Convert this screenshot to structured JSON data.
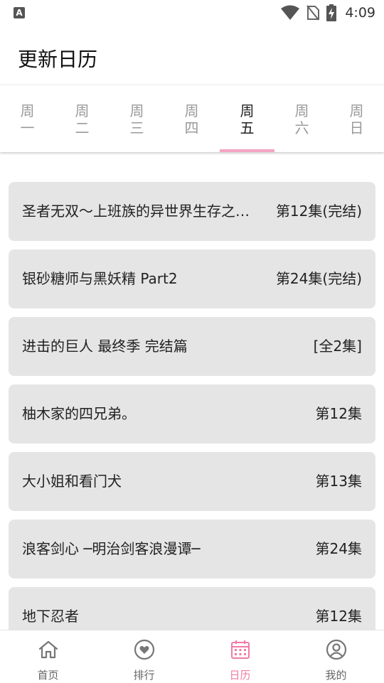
{
  "status_bar": {
    "time": "4:09",
    "notification_letter": "A"
  },
  "header": {
    "title": "更新日历"
  },
  "week_tabs": [
    {
      "line1": "周",
      "line2": "一"
    },
    {
      "line1": "周",
      "line2": "二"
    },
    {
      "line1": "周",
      "line2": "三"
    },
    {
      "line1": "周",
      "line2": "四"
    },
    {
      "line1": "周",
      "line2": "五",
      "active": true
    },
    {
      "line1": "周",
      "line2": "六"
    },
    {
      "line1": "周",
      "line2": "日"
    }
  ],
  "schedule": [
    {
      "title": "圣者无双～上班族的异世界生存之道～",
      "episode": "第12集(完结)"
    },
    {
      "title": "银砂糖师与黑妖精 Part2",
      "episode": "第24集(完结)"
    },
    {
      "title": "进击的巨人 最终季 完结篇",
      "episode": "[全2集]"
    },
    {
      "title": "柚木家的四兄弟。",
      "episode": "第12集"
    },
    {
      "title": "大小姐和看门犬",
      "episode": "第13集"
    },
    {
      "title": "浪客剑心 ─明治剑客浪漫谭─",
      "episode": "第24集"
    },
    {
      "title": "地下忍者",
      "episode": "第12集"
    }
  ],
  "bottom_nav": [
    {
      "label": "首页",
      "icon": "home-icon"
    },
    {
      "label": "排行",
      "icon": "heart-icon"
    },
    {
      "label": "日历",
      "icon": "calendar-icon",
      "active": true
    },
    {
      "label": "我的",
      "icon": "profile-icon"
    }
  ],
  "colors": {
    "accent": "#f27ba7",
    "indicator": "#f5a5c3",
    "card": "#e5e5e5"
  }
}
